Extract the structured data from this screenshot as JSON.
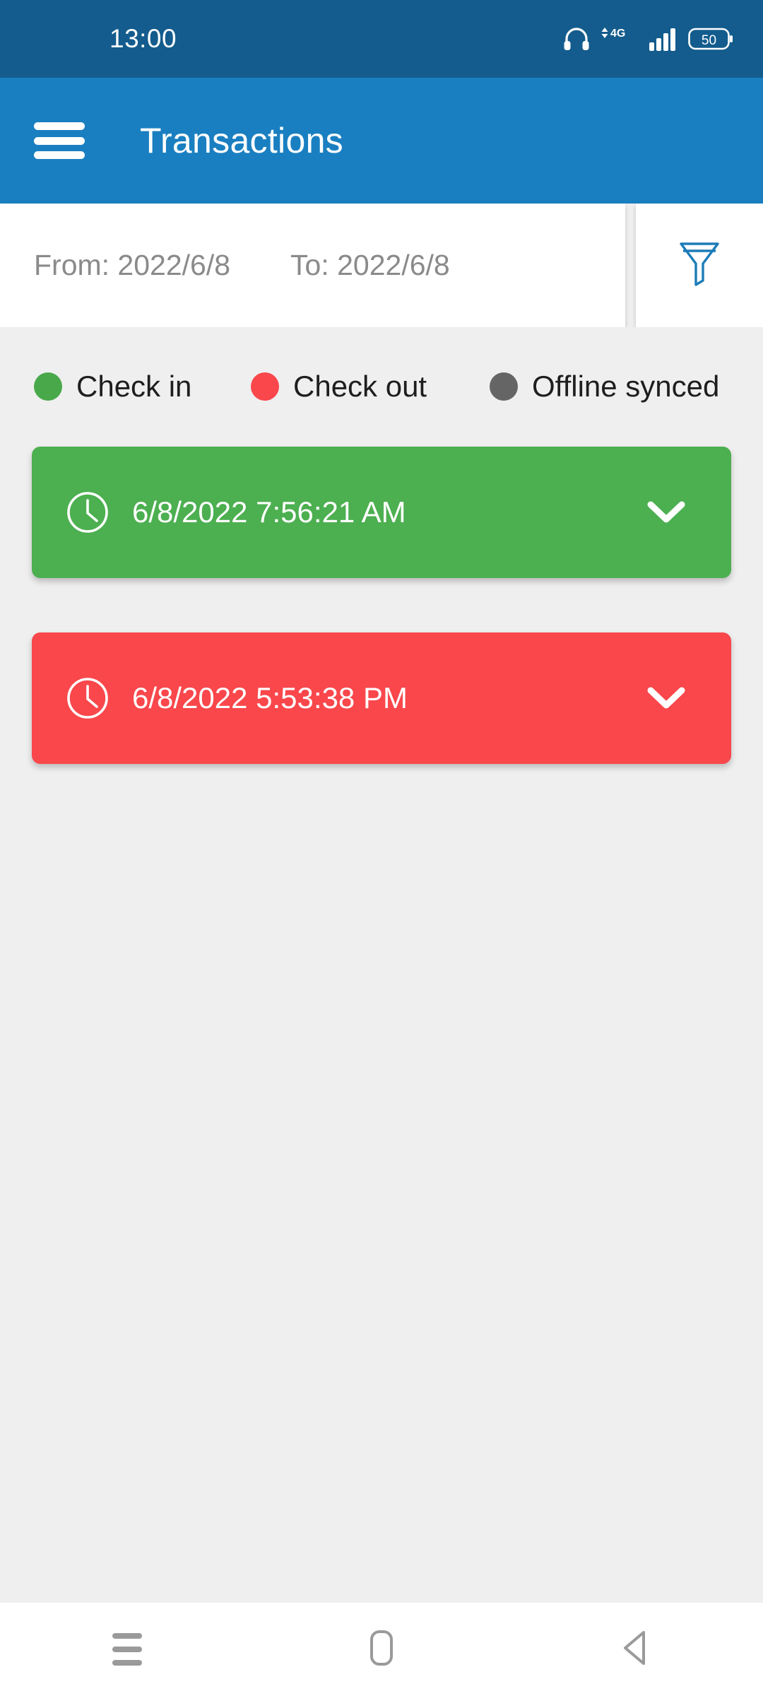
{
  "status_bar": {
    "time": "13:00",
    "battery_level": "50",
    "network_type": "4G",
    "icons": [
      "headphones-icon",
      "data-transfer-icon",
      "signal-bars-icon",
      "battery-icon"
    ],
    "background_color": "#135C8D"
  },
  "app_bar": {
    "menu_icon": "hamburger-menu-icon",
    "title": "Transactions",
    "background_color": "#1A7FC1"
  },
  "filter_bar": {
    "from_label": "From: 2022/6/8",
    "to_label": "To: 2022/6/8",
    "filter_icon": "funnel-filter-icon",
    "filter_icon_color": "#1C7CB8"
  },
  "legend": {
    "items": [
      {
        "label": "Check in",
        "color": "#49A94A"
      },
      {
        "label": "Check out",
        "color": "#F9474B"
      },
      {
        "label": "Offline synced",
        "color": "#656565"
      }
    ]
  },
  "transactions": {
    "items": [
      {
        "timestamp": "6/8/2022 7:56:21 AM",
        "type": "Check in",
        "color": "#4CAF50",
        "clock_icon": "clock-icon",
        "expand_icon": "chevron-down-icon"
      },
      {
        "timestamp": "6/8/2022 5:53:38 PM",
        "type": "Check out",
        "color": "#F9474B",
        "clock_icon": "clock-icon",
        "expand_icon": "chevron-down-icon"
      }
    ]
  },
  "nav_bar": {
    "recents": "recents-icon",
    "home": "home-icon",
    "back": "back-icon"
  }
}
